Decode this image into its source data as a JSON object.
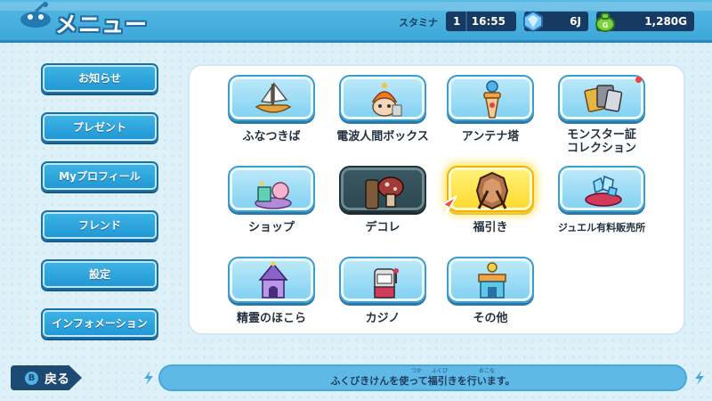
{
  "header": {
    "title": "メニュー",
    "stamina_label": "スタミナ",
    "stamina_count": "1",
    "stamina_timer": "16:55",
    "jewel_count": "6J",
    "money": "1,280G",
    "icons": [
      "menu-icon",
      "jewel-icon",
      "money-bag-icon"
    ]
  },
  "sidebar": {
    "items": [
      {
        "label": "お知らせ"
      },
      {
        "label": "プレゼント"
      },
      {
        "label": "Myプロフィール"
      },
      {
        "label": "フレンド"
      },
      {
        "label": "設定"
      },
      {
        "label": "インフォメーション"
      }
    ]
  },
  "grid": {
    "items": [
      {
        "label": "ふなつきば",
        "icon": "boat-icon",
        "state": "normal"
      },
      {
        "label": "電波人間ボックス",
        "icon": "denpa-box-icon",
        "state": "normal"
      },
      {
        "label": "アンテナ塔",
        "icon": "antenna-tower-icon",
        "state": "normal"
      },
      {
        "label": "モンスター証\nコレクション",
        "icon": "card-collection-icon",
        "state": "normal",
        "badge": true
      },
      {
        "label": "ショップ",
        "icon": "shop-icon",
        "state": "normal"
      },
      {
        "label": "デコレ",
        "icon": "decor-icon",
        "state": "disabled"
      },
      {
        "label": "福引き",
        "icon": "lottery-icon",
        "state": "selected"
      },
      {
        "label": "ジュエル有料販売所",
        "icon": "jewel-shop-icon",
        "state": "normal"
      },
      {
        "label": "精霊のほこら",
        "icon": "shrine-icon",
        "state": "normal"
      },
      {
        "label": "カジノ",
        "icon": "casino-icon",
        "state": "normal"
      },
      {
        "label": "その他",
        "icon": "other-icon",
        "state": "normal"
      }
    ]
  },
  "footer": {
    "back_key": "B",
    "back_label": "戻る",
    "hint": "ふくびきけんを使って福引きを行います。",
    "ruby": [
      "つか",
      "ふくび",
      "おこな"
    ]
  },
  "colors": {
    "header": "#3ea7d8",
    "sidebar_button": "#1f97d3",
    "selected_tile": "#ffd82c",
    "dark_tile": "#2c4852",
    "badge": "#ff3b3b",
    "footer_dark": "#1c4a73"
  }
}
